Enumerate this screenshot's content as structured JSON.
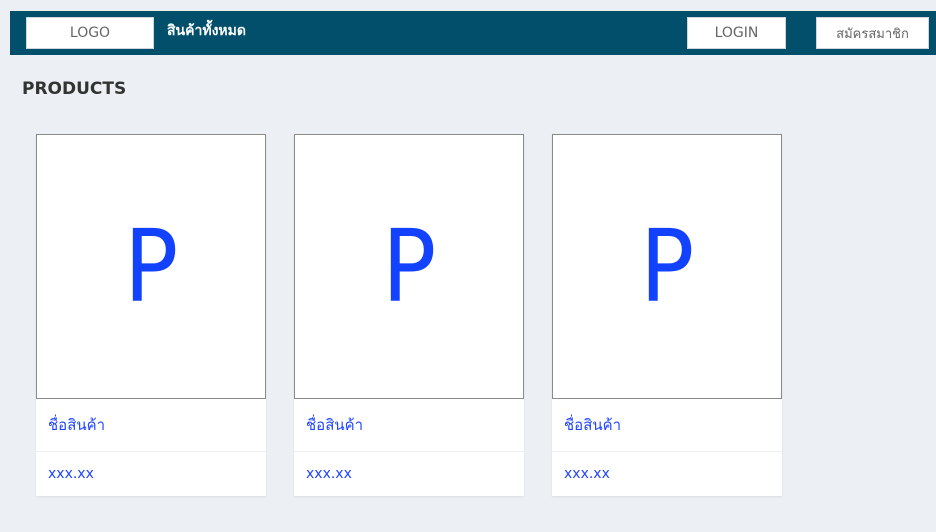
{
  "header": {
    "logo_label": "LOGO",
    "nav_all_products": "สินค้าทั้งหมด",
    "login_label": "LOGIN",
    "register_label": "สมัครสมาชิก"
  },
  "main": {
    "title": "PRODUCTS",
    "products": [
      {
        "image_letter": "P",
        "name": "ชื่อสินค้า",
        "price": "xxx.xx"
      },
      {
        "image_letter": "P",
        "name": "ชื่อสินค้า",
        "price": "xxx.xx"
      },
      {
        "image_letter": "P",
        "name": "ชื่อสินค้า",
        "price": "xxx.xx"
      }
    ]
  },
  "colors": {
    "header_bg": "#024f6c",
    "page_bg": "#eceff4",
    "link": "#1f45ff"
  }
}
